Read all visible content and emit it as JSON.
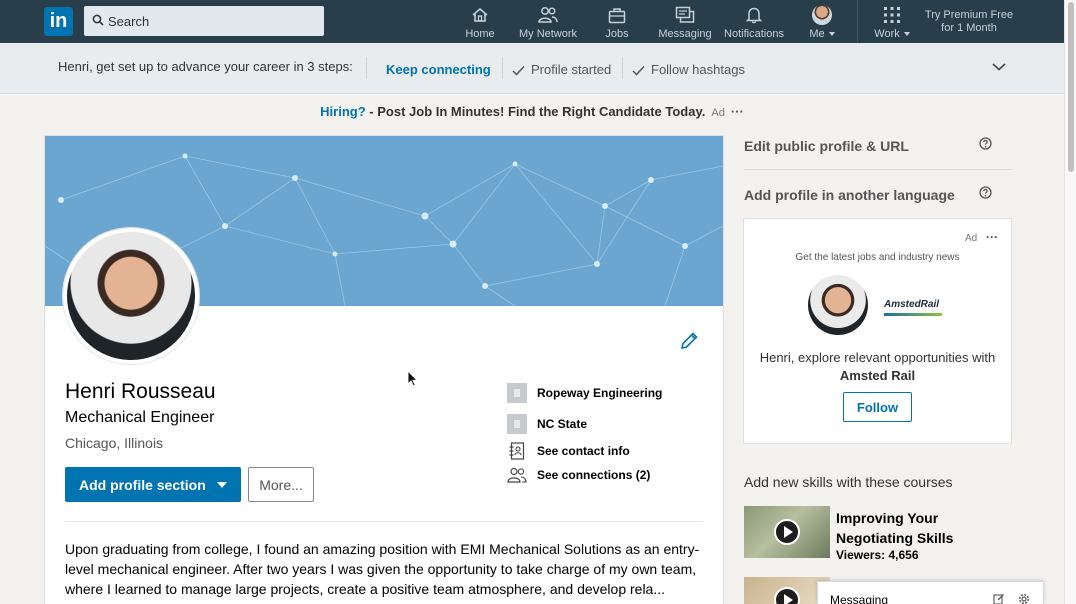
{
  "topbar": {
    "logo_text": "in",
    "search_placeholder": "Search",
    "nav": [
      {
        "label": "Home",
        "icon": "home-icon"
      },
      {
        "label": "My Network",
        "icon": "network-icon"
      },
      {
        "label": "Jobs",
        "icon": "briefcase-icon"
      },
      {
        "label": "Messaging",
        "icon": "messaging-icon"
      },
      {
        "label": "Notifications",
        "icon": "bell-icon"
      },
      {
        "label": "Me",
        "icon": "avatar"
      },
      {
        "label": "Work",
        "icon": "grid-icon"
      }
    ],
    "premium": [
      "Try Premium Free",
      "for 1 Month"
    ]
  },
  "steps": {
    "intro": "Henri, get set up to advance your career in 3 steps:",
    "keep": "Keep connecting",
    "done1": "Profile started",
    "done2": "Follow hashtags"
  },
  "ad_line": {
    "hiring": "Hiring?",
    "dash": " - ",
    "text": "Post Job In Minutes! Find the Right Candidate Today.",
    "ad": "Ad",
    "dots": "···"
  },
  "profile": {
    "name": "Henri Rousseau",
    "headline": "Mechanical Engineer",
    "location": "Chicago, Illinois",
    "add_section": "Add profile section",
    "more": "More...",
    "company": "Ropeway Engineering",
    "school": "NC State",
    "contact": "See contact info",
    "connections": "See connections (2)",
    "summary": "Upon graduating from college, I found an amazing position with EMI Mechanical Solutions as an entry-level mechanical engineer. After two years I was given the opportunity to take charge of my own team, where I learned to manage large projects, create a positive team atmosphere, and develop rela..."
  },
  "right": {
    "edit_url": "Edit public profile & URL",
    "add_language": "Add profile in another language",
    "ad_card": {
      "ad": "Ad",
      "dots": "···",
      "sub": "Get the latest jobs and industry news",
      "brand": "AmstedRail",
      "msg_prefix": "Henri, explore relevant opportunities with ",
      "msg_brand": "Amsted Rail",
      "follow": "Follow"
    },
    "courses_title": "Add new skills with these courses",
    "course": {
      "title": "Improving Your Negotiating Skills",
      "viewers": "Viewers: 4,656"
    },
    "messaging": "Messaging"
  },
  "colors": {
    "topbar": "#283e4a",
    "brand": "#0073b1",
    "banner": "#6aa6cf"
  }
}
